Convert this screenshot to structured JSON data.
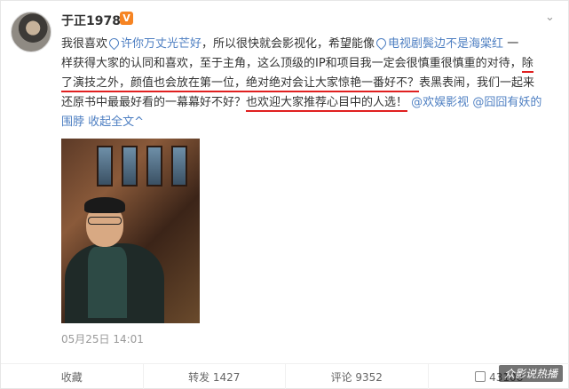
{
  "post": {
    "username": "于正1978",
    "vip_badge": "V",
    "content_lines": [
      [
        "我很喜欢",
        "许你万丈光芒好",
        "，所以很快就会影视化，希望能像",
        "电视剧鬓边不是海棠红",
        "一"
      ],
      [
        "样获得大家的认同和喜欢，至于主角，这么顶级的IP和项目我一定会很慎重很慎重的对待，",
        "除"
      ],
      [
        "了演技之外，",
        "颜值也会放在第一位，",
        "绝对绝对会让大家惊艳一番好不？",
        "表黑表闹，我们一起来"
      ],
      [
        "还原书中最最好看的一幕幕好不好？",
        "也欢迎大家推荐心目中的人选！",
        "@欢娱影视",
        "@囧囧有妖的"
      ],
      [
        "围脖",
        "收起全文",
        "^"
      ]
    ],
    "timestamp": "05月25日 14:01",
    "actions": {
      "favorite": "收藏",
      "repost": "转发 1427",
      "comment": "评论 9352",
      "like": "43108"
    },
    "watermark": "众影说热播",
    "more_icon": "chevron-down-icon"
  },
  "colors": {
    "link_orange": "#eb7350",
    "link_blue": "#4e7fc2",
    "underline_red": "#e02020",
    "vip_orange": "#f68423"
  }
}
